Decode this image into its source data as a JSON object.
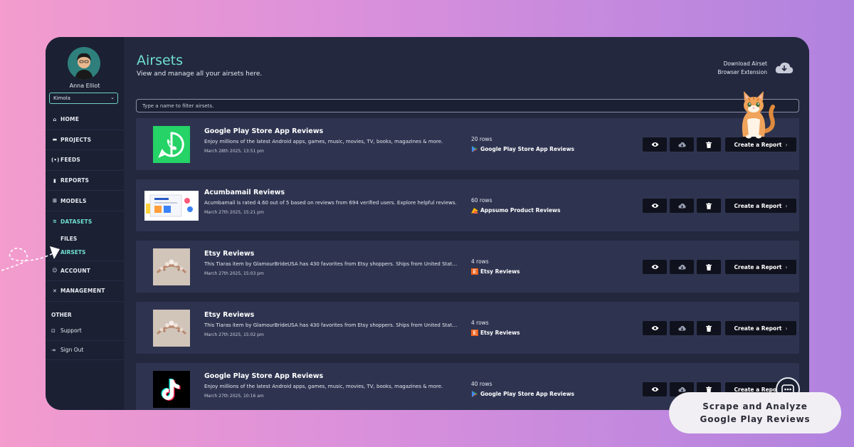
{
  "user": {
    "name": "Anna Elliot",
    "org": "Kimola"
  },
  "nav": {
    "items": [
      {
        "label": "HOME",
        "icon": "home-icon"
      },
      {
        "label": "PROJECTS",
        "icon": "folder-icon"
      },
      {
        "label": "FEEDS",
        "icon": "broadcast-icon"
      },
      {
        "label": "REPORTS",
        "icon": "bar-chart-icon"
      },
      {
        "label": "MODELS",
        "icon": "model-icon"
      },
      {
        "label": "DATASETS",
        "icon": "layers-icon"
      }
    ],
    "subitems": [
      {
        "label": "FILES"
      },
      {
        "label": "AIRSETS"
      }
    ],
    "items2": [
      {
        "label": "ACCOUNT",
        "icon": "user-icon"
      },
      {
        "label": "MANAGEMENT",
        "icon": "tools-icon"
      }
    ],
    "other_heading": "OTHER",
    "other": [
      {
        "label": "Support",
        "icon": "support-icon"
      },
      {
        "label": "Sign Out",
        "icon": "sign-out-icon"
      }
    ]
  },
  "header": {
    "title": "Airsets",
    "subtitle": "View and manage all your airsets here.",
    "download_line1": "Download Airset",
    "download_line2": "Browser Extension"
  },
  "filter": {
    "placeholder": "Type a name to filter airsets."
  },
  "airsets": [
    {
      "title": "Google Play Store App Reviews",
      "description": "Enjoy millions of the latest Android apps, games, music, movies, TV, books, magazines & more.",
      "date": "March 28th 2025, 13:51 pm",
      "rows": "20 rows",
      "source": "Google Play Store App Reviews",
      "thumb": "whatsapp"
    },
    {
      "title": "Acumbamail Reviews",
      "description": "Acumbamail is rated 4.60 out of 5 based on reviews from 694 verified users. Explore helpful reviews.",
      "date": "March 27th 2025, 15:21 pm",
      "rows": "60 rows",
      "source": "Appsumo Product Reviews",
      "thumb": "acumbamail"
    },
    {
      "title": "Etsy Reviews",
      "description": "This Tiaras item by GlamourBrideUSA has 430 favorites from Etsy shoppers. Ships from United States.",
      "date": "March 27th 2025, 15:03 pm",
      "rows": "4 rows",
      "source": "Etsy Reviews",
      "thumb": "tiara"
    },
    {
      "title": "Etsy Reviews",
      "description": "This Tiaras item by GlamourBrideUSA has 430 favorites from Etsy shoppers. Ships from United States.",
      "date": "March 27th 2025, 15:02 pm",
      "rows": "4 rows",
      "source": "Etsy Reviews",
      "thumb": "tiara"
    },
    {
      "title": "Google Play Store App Reviews",
      "description": "Enjoy millions of the latest Android apps, games, music, movies, TV, books, magazines & more.",
      "date": "March 27th 2025, 10:16 am",
      "rows": "40 rows",
      "source": "Google Play Store App Reviews",
      "thumb": "tiktok"
    }
  ],
  "actions": {
    "report_label": "Create a Report",
    "report_chevron": "›"
  },
  "promo": {
    "line1": "Scrape and Analyze",
    "line2": "Google Play Reviews"
  },
  "colors": {
    "accent": "#6fe0cf",
    "sidebar": "#1b2033",
    "card": "#2e3450",
    "main": "#23283f"
  }
}
